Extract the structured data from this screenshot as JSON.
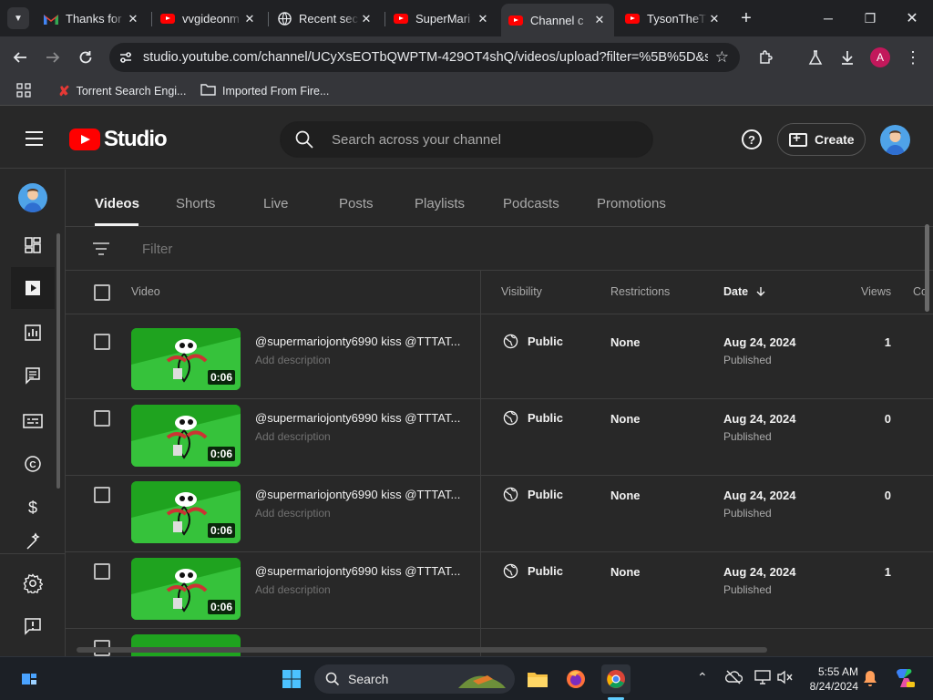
{
  "browser": {
    "tabs": [
      {
        "title": "Thanks for",
        "favicon": "gmail-icon"
      },
      {
        "title": "vvgideonm",
        "favicon": "youtube-icon"
      },
      {
        "title": "Recent sec",
        "favicon": "globe-icon"
      },
      {
        "title": "SuperMari",
        "favicon": "youtube-icon"
      },
      {
        "title": "Channel c",
        "favicon": "youtube-icon",
        "active": true
      },
      {
        "title": "TysonTheT",
        "favicon": "youtube-icon"
      }
    ],
    "url": "studio.youtube.com/channel/UCyXsEOTbQWPTM-429OT4shQ/videos/upload?filter=%5B%5D&so...",
    "profile_letter": "A",
    "bookmarks": [
      {
        "label": "Torrent Search Engi...",
        "icon": "x-icon"
      },
      {
        "label": "Imported From Fire...",
        "icon": "folder-icon"
      }
    ]
  },
  "studio": {
    "logo_text": "Studio",
    "search_placeholder": "Search across your channel",
    "create_label": "Create",
    "help_glyph": "?",
    "content_tabs": [
      "Videos",
      "Shorts",
      "Live",
      "Posts",
      "Playlists",
      "Podcasts",
      "Promotions"
    ],
    "active_tab": "Videos",
    "filter_placeholder": "Filter",
    "columns": {
      "video": "Video",
      "visibility": "Visibility",
      "restrictions": "Restrictions",
      "date": "Date",
      "views": "Views",
      "comments": "Co"
    },
    "rows": [
      {
        "title": "@supermariojonty6990 kiss @TTTAT...",
        "description": "Add description",
        "duration": "0:06",
        "visibility": "Public",
        "restrictions": "None",
        "date": "Aug 24, 2024",
        "date_status": "Published",
        "views": "1"
      },
      {
        "title": "@supermariojonty6990 kiss @TTTAT...",
        "description": "Add description",
        "duration": "0:06",
        "visibility": "Public",
        "restrictions": "None",
        "date": "Aug 24, 2024",
        "date_status": "Published",
        "views": "0"
      },
      {
        "title": "@supermariojonty6990 kiss @TTTAT...",
        "description": "Add description",
        "duration": "0:06",
        "visibility": "Public",
        "restrictions": "None",
        "date": "Aug 24, 2024",
        "date_status": "Published",
        "views": "0"
      },
      {
        "title": "@supermariojonty6990 kiss @TTTAT...",
        "description": "Add description",
        "duration": "0:06",
        "visibility": "Public",
        "restrictions": "None",
        "date": "Aug 24, 2024",
        "date_status": "Published",
        "views": "1"
      }
    ],
    "sidenav_icons": [
      "dashboard-icon",
      "content-icon",
      "analytics-icon",
      "comments-icon",
      "subtitles-icon",
      "copyright-icon",
      "earn-icon",
      "customization-icon",
      "settings-icon",
      "feedback-icon"
    ]
  },
  "taskbar": {
    "search_label": "Search",
    "time": "5:55 AM",
    "date": "8/24/2024"
  },
  "colors": {
    "accent_red": "#ff0000",
    "bg": "#282828",
    "thumb_green": "#1fa31f"
  }
}
